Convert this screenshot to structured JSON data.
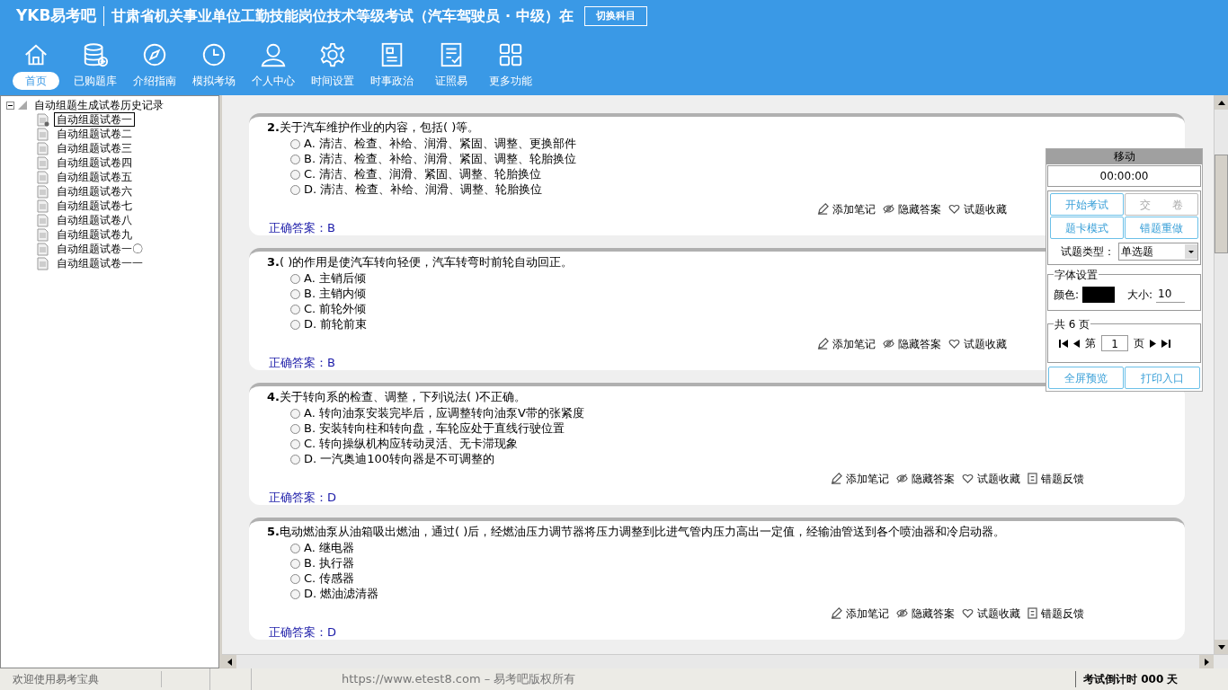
{
  "header": {
    "logo": "YKB易考吧",
    "title": "甘肃省机关事业单位工勤技能岗位技术等级考试（汽车驾驶员 · 中级）在",
    "switch_button": "切换科目"
  },
  "toolbar": [
    {
      "kind": "home",
      "label": "首页",
      "selected": true
    },
    {
      "kind": "database",
      "label": "已购题库",
      "selected": false
    },
    {
      "kind": "compass",
      "label": "介绍指南",
      "selected": false
    },
    {
      "kind": "clock",
      "label": "模拟考场",
      "selected": false
    },
    {
      "kind": "user",
      "label": "个人中心",
      "selected": false
    },
    {
      "kind": "gear",
      "label": "时间设置",
      "selected": false
    },
    {
      "kind": "news",
      "label": "时事政治",
      "selected": false
    },
    {
      "kind": "checklist",
      "label": "证照易",
      "selected": false
    },
    {
      "kind": "grid",
      "label": "更多功能",
      "selected": false
    }
  ],
  "tree": {
    "label": "自动组题生成试卷历史记录",
    "expanded": true,
    "children": [
      {
        "label": "自动组题试卷一",
        "selected": true
      },
      {
        "label": "自动组题试卷二",
        "selected": false
      },
      {
        "label": "自动组题试卷三",
        "selected": false
      },
      {
        "label": "自动组题试卷四",
        "selected": false
      },
      {
        "label": "自动组题试卷五",
        "selected": false
      },
      {
        "label": "自动组题试卷六",
        "selected": false
      },
      {
        "label": "自动组题试卷七",
        "selected": false
      },
      {
        "label": "自动组题试卷八",
        "selected": false
      },
      {
        "label": "自动组题试卷九",
        "selected": false
      },
      {
        "label": "自动组题试卷一〇",
        "selected": false
      },
      {
        "label": "自动组题试卷一一",
        "selected": false
      }
    ]
  },
  "questions": [
    {
      "number": "2.",
      "text": "关于汽车维护作业的内容，包括( )等。",
      "options": [
        {
          "letter": "A.",
          "text": "清洁、检查、补给、润滑、紧固、调整、更换部件",
          "selected": false
        },
        {
          "letter": "B.",
          "text": "清洁、检查、补给、润滑、紧固、调整、轮胎换位",
          "selected": false
        },
        {
          "letter": "C.",
          "text": "清洁、检查、润滑、紧固、调整、轮胎换位",
          "selected": false
        },
        {
          "letter": "D.",
          "text": "清洁、检查、补给、润滑、调整、轮胎换位",
          "selected": false
        }
      ],
      "answer_label": "正确答案：",
      "answer": "B",
      "actions": [
        {
          "kind": "pencil",
          "label": "添加笔记"
        },
        {
          "kind": "eye",
          "label": "隐藏答案"
        },
        {
          "kind": "heart",
          "label": "试题收藏"
        }
      ]
    },
    {
      "number": "3.",
      "text": "( )的作用是使汽车转向轻便，汽车转弯时前轮自动回正。",
      "options": [
        {
          "letter": "A.",
          "text": "主销后倾",
          "selected": false
        },
        {
          "letter": "B.",
          "text": "主销内倾",
          "selected": false
        },
        {
          "letter": "C.",
          "text": "前轮外倾",
          "selected": false
        },
        {
          "letter": "D.",
          "text": "前轮前束",
          "selected": false
        }
      ],
      "answer_label": "正确答案：",
      "answer": "B",
      "actions": [
        {
          "kind": "pencil",
          "label": "添加笔记"
        },
        {
          "kind": "eye",
          "label": "隐藏答案"
        },
        {
          "kind": "heart",
          "label": "试题收藏"
        }
      ]
    },
    {
      "number": "4.",
      "text": "关于转向系的检查、调整，下列说法( )不正确。",
      "options": [
        {
          "letter": "A.",
          "text": "转向油泵安装完毕后，应调整转向油泵V带的张紧度",
          "selected": false
        },
        {
          "letter": "B.",
          "text": "安装转向柱和转向盘，车轮应处于直线行驶位置",
          "selected": false
        },
        {
          "letter": "C.",
          "text": "转向操纵机构应转动灵活、无卡滞现象",
          "selected": false
        },
        {
          "letter": "D.",
          "text": "一汽奥迪100转向器是不可调整的",
          "selected": false
        }
      ],
      "answer_label": "正确答案：",
      "answer": "D",
      "actions": [
        {
          "kind": "pencil",
          "label": "添加笔记"
        },
        {
          "kind": "eye",
          "label": "隐藏答案"
        },
        {
          "kind": "heart",
          "label": "试题收藏"
        },
        {
          "kind": "flag",
          "label": "错题反馈"
        }
      ]
    },
    {
      "number": "5.",
      "text": "电动燃油泵从油箱吸出燃油，通过( )后，经燃油压力调节器将压力调整到比进气管内压力高出一定值，经输油管送到各个喷油器和冷启动器。",
      "options": [
        {
          "letter": "A.",
          "text": "继电器",
          "selected": false
        },
        {
          "letter": "B.",
          "text": "执行器",
          "selected": false
        },
        {
          "letter": "C.",
          "text": "传感器",
          "selected": false
        },
        {
          "letter": "D.",
          "text": "燃油滤清器",
          "selected": false
        }
      ],
      "answer_label": "正确答案：",
      "answer": "D",
      "actions": [
        {
          "kind": "pencil",
          "label": "添加笔记"
        },
        {
          "kind": "eye",
          "label": "隐藏答案"
        },
        {
          "kind": "heart",
          "label": "试题收藏"
        },
        {
          "kind": "flag",
          "label": "错题反馈"
        }
      ]
    }
  ],
  "panel": {
    "title": "移动",
    "timer": "00:00:00",
    "buttons": [
      {
        "label": "开始考试",
        "disabled": false
      },
      {
        "label": "交　　卷",
        "disabled": true
      },
      {
        "label": "题卡模式",
        "disabled": false
      },
      {
        "label": "错题重做",
        "disabled": false
      }
    ],
    "type_label": "试题类型：",
    "type_value": "单选题",
    "font_group": "字体设置",
    "color_label": "颜色:",
    "color": "#000000",
    "size_label": "大小:",
    "size_value": "10",
    "pages_group": "共 6 页",
    "page_prefix": "第",
    "page_value": "1",
    "page_suffix": "页",
    "bottom_buttons": [
      "全屏预览",
      "打印入口"
    ]
  },
  "status_bar": {
    "welcome": "欢迎使用易考宝典",
    "copyright": "https://www.etest8.com – 易考吧版权所有",
    "countdown": "考试倒计时 000 天"
  }
}
